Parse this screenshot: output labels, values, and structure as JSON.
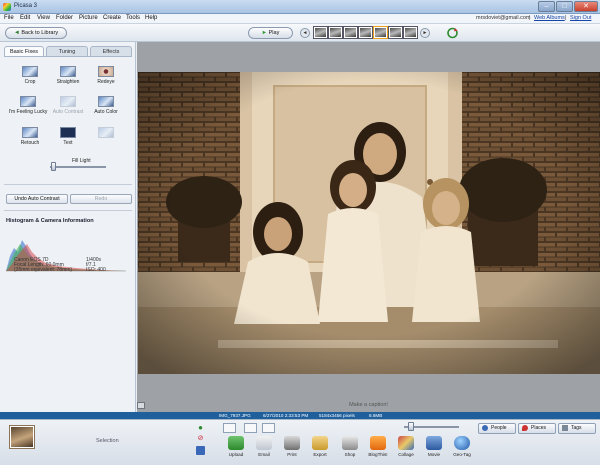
{
  "window": {
    "title": "Picasa 3",
    "min_glyph": "–",
    "max_glyph": "□",
    "close_glyph": "✕"
  },
  "menu": {
    "items": [
      "File",
      "Edit",
      "View",
      "Folder",
      "Picture",
      "Create",
      "Tools",
      "Help"
    ],
    "account": "mrsdoviet@gmail.com",
    "separator": "|",
    "web_albums": "Web Albums",
    "sign_out": "Sign Out"
  },
  "toolbar": {
    "back_label": "Back to Library",
    "back_glyph": "◄",
    "play_label": "Play",
    "play_glyph": "►",
    "prev_glyph": "◄",
    "next_glyph": "►"
  },
  "edit_panel": {
    "tabs": [
      "Basic Fixes",
      "Tuning",
      "Effects"
    ],
    "tools": [
      {
        "label": "Crop"
      },
      {
        "label": "Straighten"
      },
      {
        "label": "Redeye"
      },
      {
        "label": "I'm Feeling Lucky"
      },
      {
        "label": "Auto Contrast"
      },
      {
        "label": "Auto Color"
      },
      {
        "label": "Retouch"
      },
      {
        "label": "Text"
      }
    ],
    "fill_light_label": "Fill Light",
    "fill_light_level": 0.05,
    "undo_label": "Undo Auto Contrast",
    "redo_label": "Redo",
    "histogram_title": "Histogram & Camera Information",
    "camera_info": {
      "model": "Canon EOS 7D",
      "focal_length": "Focal Length: 60.0mm",
      "equivalent": "(35mm equivalent: 78mm)",
      "shutter": "1/400s",
      "aperture": "f/7.1",
      "iso": "ISO: 400"
    }
  },
  "viewer": {
    "caption_placeholder": "Make a caption!"
  },
  "status": {
    "filename": "IMG_7937.JPG",
    "date": "6/27/2010 2:33:53 PM",
    "dimensions": "5184x3456 pixels",
    "size": "8.6MB"
  },
  "tray": {
    "selection_label": "Selection",
    "actions": [
      "Upload",
      "Email",
      "Print",
      "Export",
      "Shop",
      "BlogThis!",
      "Collage",
      "Movie",
      "Geo-Tag"
    ],
    "people_label": "People",
    "places_label": "Places",
    "tags_label": "Tags"
  },
  "colors": {
    "statusbar": "#1f5f9c",
    "link": "#1646a8",
    "sepia": "#8a6845"
  }
}
